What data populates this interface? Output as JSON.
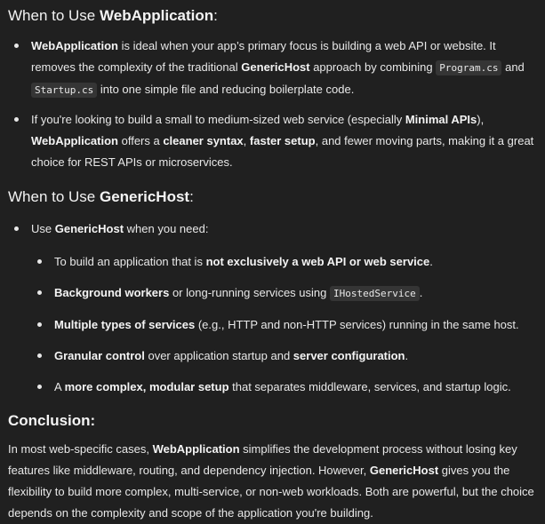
{
  "section1": {
    "title_prefix": "When to Use ",
    "title_bold": "WebApplication",
    "title_suffix": ":",
    "bullet1": {
      "b1": "WebApplication",
      "t1": " is ideal when your app’s primary focus is building a web API or website. It removes the complexity of the traditional ",
      "b2": "GenericHost",
      "t2": " approach by combining ",
      "code1": "Program.cs",
      "t3": " and ",
      "code2": "Startup.cs",
      "t4": " into one simple file and reducing boilerplate code."
    },
    "bullet2": {
      "t1": "If you're looking to build a small to medium-sized web service (especially ",
      "b1": "Minimal APIs",
      "t2": "), ",
      "b2": "WebApplication",
      "t3": " offers a ",
      "b3": "cleaner syntax",
      "t4": ", ",
      "b4": "faster setup",
      "t5": ", and fewer moving parts, making it a great choice for REST APIs or microservices."
    }
  },
  "section2": {
    "title_prefix": "When to Use ",
    "title_bold": "GenericHost",
    "title_suffix": ":",
    "intro": {
      "t1": "Use ",
      "b1": "GenericHost",
      "t2": " when you need:"
    },
    "items": [
      {
        "t1": "To build an application that is ",
        "b1": "not exclusively a web API or web service",
        "t2": "."
      },
      {
        "b1": "Background workers",
        "t1": " or long-running services using ",
        "code": "IHostedService",
        "t2": "."
      },
      {
        "b1": "Multiple types of services",
        "t1": " (e.g., HTTP and non-HTTP services) running in the same host."
      },
      {
        "b1": "Granular control",
        "t1": " over application startup and ",
        "b2": "server configuration",
        "t2": "."
      },
      {
        "t1": "A ",
        "b1": "more complex, modular setup",
        "t2": " that separates middleware, services, and startup logic."
      }
    ]
  },
  "section3": {
    "title": "Conclusion:",
    "t1": "In most web-specific cases, ",
    "b1": "WebApplication",
    "t2": " simplifies the development process without losing key features like middleware, routing, and dependency injection. However, ",
    "b2": "GenericHost",
    "t3": " gives you the flexibility to build more complex, multi-service, or non-web workloads. Both are powerful, but the choice depends on the complexity and scope of the application you're building."
  }
}
